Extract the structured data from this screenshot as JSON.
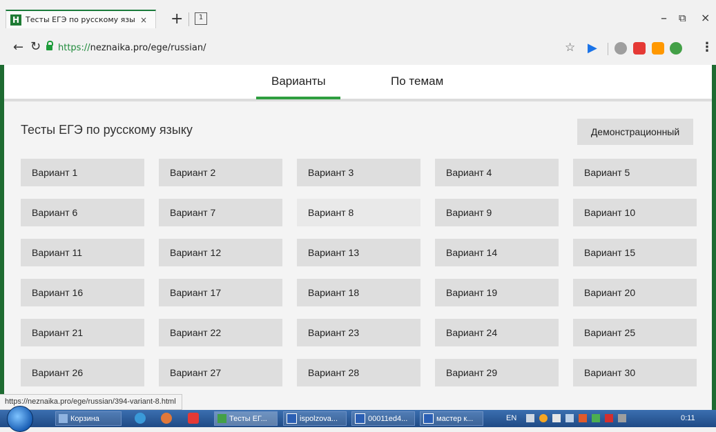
{
  "browser": {
    "tab_title": "Тесты ЕГЭ по русскому язы",
    "tab_close": "×",
    "favicon_letter": "Н",
    "new_tab": "+",
    "tab_count": "1",
    "url_scheme": "https://",
    "url_rest": "neznaika.pro/ege/russian/",
    "window_minimize": "–",
    "window_restore": "⧉",
    "window_close": "×"
  },
  "nav": {
    "tabs": [
      "Варианты",
      "По темам"
    ],
    "active_tab": "Варианты"
  },
  "page": {
    "heading": "Тесты ЕГЭ по русскому языку",
    "demo_button": "Демонстрационный",
    "variants": [
      "Вариант 1",
      "Вариант 2",
      "Вариант 3",
      "Вариант 4",
      "Вариант 5",
      "Вариант 6",
      "Вариант 7",
      "Вариант 8",
      "Вариант 9",
      "Вариант 10",
      "Вариант 11",
      "Вариант 12",
      "Вариант 13",
      "Вариант 14",
      "Вариант 15",
      "Вариант 16",
      "Вариант 17",
      "Вариант 18",
      "Вариант 19",
      "Вариант 20",
      "Вариант 21",
      "Вариант 22",
      "Вариант 23",
      "Вариант 24",
      "Вариант 25",
      "Вариант 26",
      "Вариант 27",
      "Вариант 28",
      "Вариант 29",
      "Вариант 30"
    ],
    "hovered_variant": "Вариант 8"
  },
  "status_bar": {
    "url": "https://neznaika.pro/ege/russian/394-variant-8.html"
  },
  "taskbar": {
    "items": [
      {
        "label": "Корзина",
        "icon": "recycle-bin-icon"
      },
      {
        "label": "Тесты ЕГ...",
        "icon": "browser-icon"
      },
      {
        "label": "ispolzova...",
        "icon": "word-icon"
      },
      {
        "label": "00011ed4...",
        "icon": "word-icon"
      },
      {
        "label": "мастер к...",
        "icon": "word-icon"
      }
    ],
    "language": "EN",
    "clock": "0:11"
  },
  "colors": {
    "brand_green": "#1e6b31",
    "active_underline": "#2e9e3f",
    "button_gray": "#dedede"
  }
}
